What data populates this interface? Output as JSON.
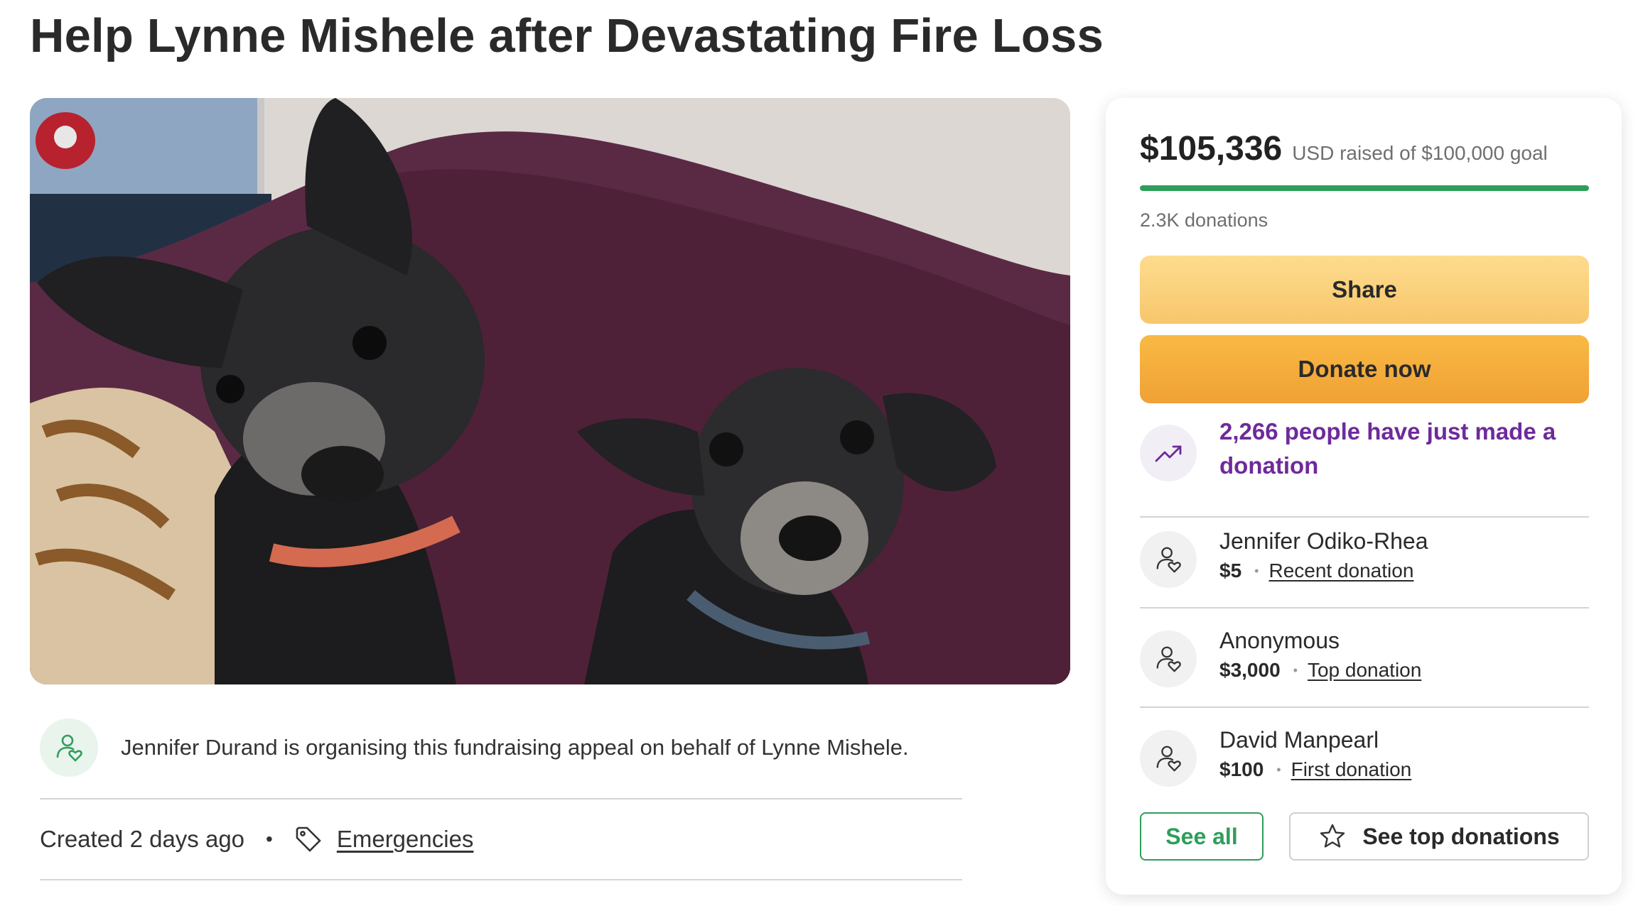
{
  "page": {
    "title": "Help Lynne Mishele after Devastating Fire Loss"
  },
  "hero_image": {
    "subject": "two dogs sitting on a purple couch"
  },
  "organiser": {
    "text": "Jennifer Durand is organising this fundraising appeal on behalf of Lynne Mishele.",
    "icon": "person-heart-icon"
  },
  "meta": {
    "created": "Created 2 days ago",
    "separator": "•",
    "category": "Emergencies",
    "category_icon": "tag-icon"
  },
  "donation_panel": {
    "raised_amount": "$105,336",
    "raised_goal_text": "USD raised of $100,000 goal",
    "progress_percent": 100,
    "donations_count": "2.3K donations",
    "share_label": "Share",
    "donate_label": "Donate now",
    "trend_text": "2,266 people have just made a donation",
    "trend_icon": "trending-up-icon",
    "donors": [
      {
        "name": "Jennifer Odiko-Rhea",
        "amount": "$5",
        "type": "Recent donation",
        "icon": "person-heart-icon"
      },
      {
        "name": "Anonymous",
        "amount": "$3,000",
        "type": "Top donation",
        "icon": "person-heart-icon"
      },
      {
        "name": "David Manpearl",
        "amount": "$100",
        "type": "First donation",
        "icon": "person-heart-icon"
      }
    ],
    "see_all_label": "See all",
    "see_top_label": "See top donations",
    "see_top_icon": "star-icon"
  },
  "colors": {
    "accent_green": "#2f9e5b",
    "share_button": "#f8c66b",
    "donate_button": "#f0a135",
    "trend_purple": "#6e2a9b"
  }
}
